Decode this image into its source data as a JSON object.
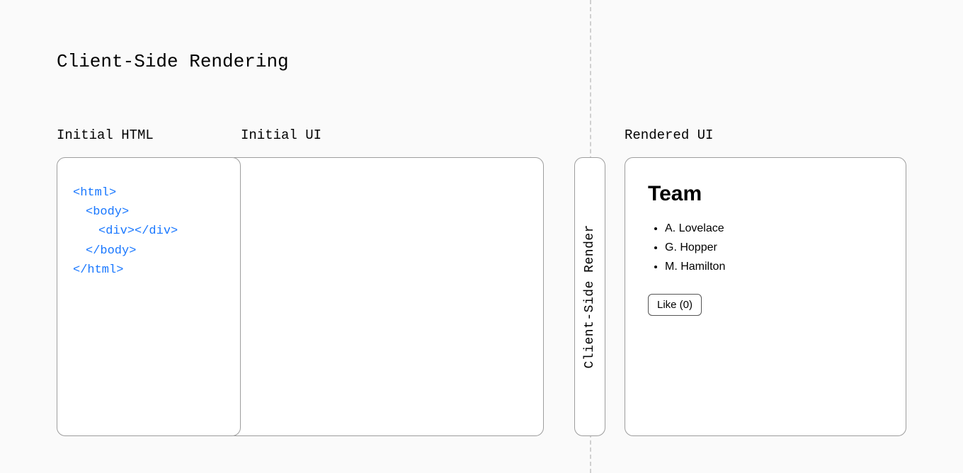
{
  "title": "Client-Side Rendering",
  "labels": {
    "initial_html": "Initial HTML",
    "initial_ui": "Initial UI",
    "rendered_ui": "Rendered UI"
  },
  "code": {
    "line1": "<html>",
    "line2": "<body>",
    "line3": "<div></div>",
    "line4": "</body>",
    "line5": "</html>"
  },
  "csr_label": "Client-Side Render",
  "rendered": {
    "heading": "Team",
    "items": [
      "A. Lovelace",
      "G. Hopper",
      "M. Hamilton"
    ],
    "like_label": "Like (0)"
  }
}
